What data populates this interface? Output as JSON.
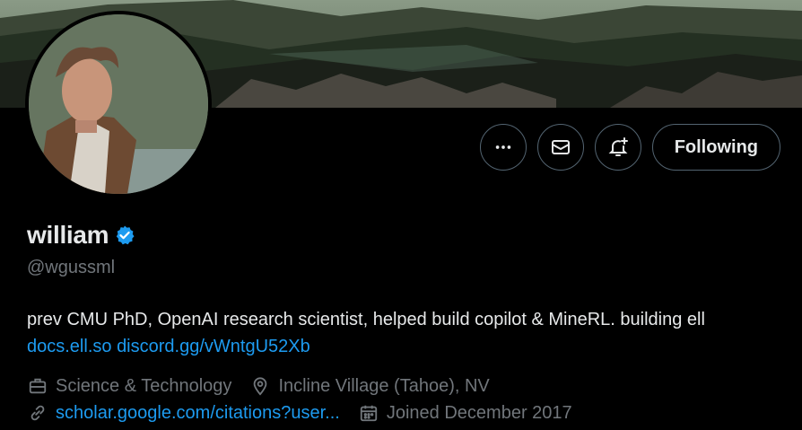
{
  "profile": {
    "name": "william",
    "handle": "@wgussml",
    "verified": true,
    "bio_text": "prev CMU PhD, OpenAI research scientist, helped build copilot & MineRL. building ell",
    "bio_links": [
      "docs.ell.so",
      "discord.gg/vWntgU52Xb"
    ]
  },
  "actions": {
    "more_icon": "more-horizontal-icon",
    "message_icon": "envelope-icon",
    "notify_icon": "bell-plus-icon",
    "follow_label": "Following"
  },
  "meta": {
    "category": "Science & Technology",
    "location": "Incline Village (Tahoe), NV",
    "website": "scholar.google.com/citations?user...",
    "joined": "Joined December 2017"
  },
  "colors": {
    "background": "#000000",
    "text": "#e7e9ea",
    "muted": "#71767b",
    "link": "#1d9bf0",
    "verified_badge": "#1d9bf0",
    "border": "#536471"
  }
}
